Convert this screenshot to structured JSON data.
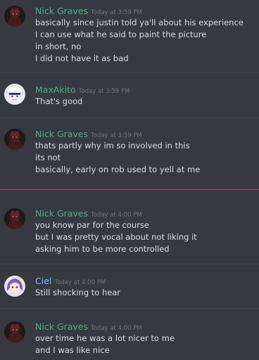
{
  "colors": {
    "background": "#36393f",
    "green_name": "#43b581",
    "blue_name": "#7eb6ff",
    "timestamp": "#72767d",
    "text": "#dcddde",
    "new_messages_divider": "#c0403d",
    "divider": "#40434a"
  },
  "messages": [
    {
      "author": "Nick Graves",
      "timestamp": "Today at 3:59 PM",
      "avatar": "dark-red-character-avatar",
      "lines": [
        "basically since justin told ya'll about his experience",
        "I can use what he said to paint the picture",
        "in short, no",
        "I did not have it as bad"
      ]
    },
    {
      "author": "MaxAkito",
      "timestamp": "Today at 3:59 PM",
      "avatar": "white-anime-character-avatar",
      "lines": [
        "That's good"
      ]
    },
    {
      "author": "Nick Graves",
      "timestamp": "Today at 3:59 PM",
      "avatar": "dark-red-character-avatar",
      "lines": [
        "thats partly why im so involved in this",
        "its not",
        "basically, early on rob used to yell at me"
      ]
    },
    {
      "author": "Nick Graves",
      "timestamp": "Today at 4:00 PM",
      "avatar": "dark-red-character-avatar",
      "lines": [
        "you know par for the course",
        "but I was pretty vocal about not liking it",
        "asking him to be more controlled"
      ]
    },
    {
      "author": "Ciel",
      "timestamp": "Today at 4:00 PM",
      "avatar": "purple-haired-anime-avatar",
      "lines": [
        "Still shocking to hear"
      ]
    },
    {
      "author": "Nick Graves",
      "timestamp": "Today at 4:00 PM",
      "avatar": "dark-red-character-avatar",
      "lines": [
        "over time he was a lot nicer to me",
        "and I was like nice"
      ]
    }
  ]
}
